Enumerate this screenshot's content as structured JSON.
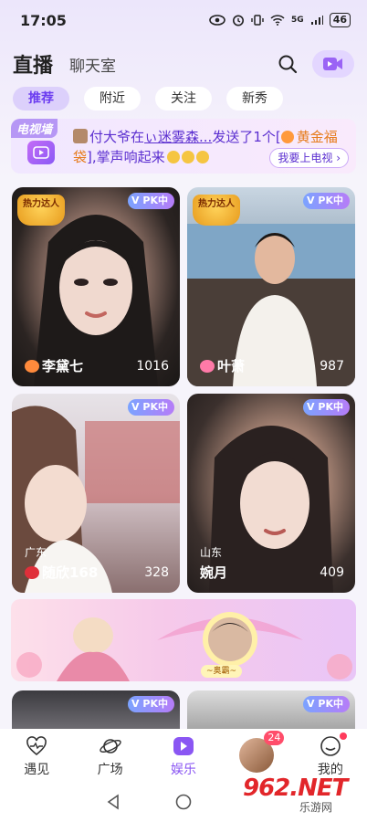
{
  "status_bar": {
    "time": "17:05",
    "battery": "46",
    "network": "5G"
  },
  "header": {
    "title": "直播",
    "subtitle": "聊天室"
  },
  "tabs": [
    {
      "label": "推荐",
      "active": true
    },
    {
      "label": "附近",
      "active": false
    },
    {
      "label": "关注",
      "active": false
    },
    {
      "label": "新秀",
      "active": false
    }
  ],
  "tv_banner": {
    "label": "电视墙",
    "line_user": "付大爷在",
    "line_target": "ぃ迷雾森...",
    "line_mid": "发送了1个[",
    "line_gift": "黄金福袋",
    "line_end": "],掌声响起来",
    "button": "我要上电视"
  },
  "pk_label": "PK中",
  "power_badge": "热力达人",
  "cards": [
    {
      "name": "李黛七",
      "region": "",
      "count": "1016",
      "power": true
    },
    {
      "name": "叶萧",
      "region": "",
      "count": "987",
      "power": true
    },
    {
      "name": "随欣168",
      "region": "广东",
      "count": "328",
      "power": false
    },
    {
      "name": "婉月",
      "region": "山东",
      "count": "409",
      "power": false
    }
  ],
  "promo": {
    "pill": "~奥霸~"
  },
  "bottom_nav": [
    {
      "label": "遇见",
      "icon": "heart-pulse-icon",
      "active": false
    },
    {
      "label": "广场",
      "icon": "planet-icon",
      "active": false
    },
    {
      "label": "娱乐",
      "icon": "play-icon",
      "active": true
    },
    {
      "label": "",
      "icon": "avatar",
      "active": false,
      "badge": "24"
    },
    {
      "label": "我的",
      "icon": "smile-icon",
      "active": false,
      "dot": true
    }
  ],
  "watermark": {
    "brand": "962.NET",
    "sub": "乐游网"
  },
  "colors": {
    "accent": "#8a56f3",
    "badge": "#ff4d6a",
    "gift": "#e67c1c"
  }
}
